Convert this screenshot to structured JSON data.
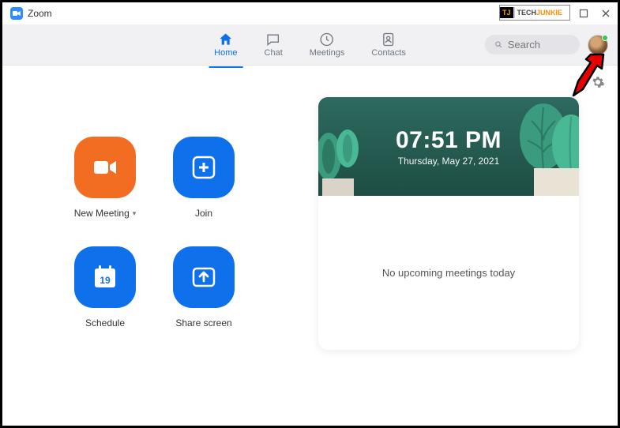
{
  "window": {
    "title": "Zoom"
  },
  "watermark": {
    "tj": "TJ",
    "pre": "TECH",
    "post": "JUNKIE"
  },
  "nav": {
    "tabs": [
      {
        "label": "Home",
        "icon": "home-icon",
        "active": true
      },
      {
        "label": "Chat",
        "icon": "chat-icon",
        "active": false
      },
      {
        "label": "Meetings",
        "icon": "clock-icon",
        "active": false
      },
      {
        "label": "Contacts",
        "icon": "contacts-icon",
        "active": false
      }
    ]
  },
  "search": {
    "placeholder": "Search"
  },
  "actions": {
    "new_meeting": "New Meeting",
    "join": "Join",
    "schedule": "Schedule",
    "schedule_day": "19",
    "share_screen": "Share screen"
  },
  "clock": {
    "time": "07:51 PM",
    "date": "Thursday, May 27, 2021"
  },
  "meetings": {
    "empty_text": "No upcoming meetings today"
  }
}
